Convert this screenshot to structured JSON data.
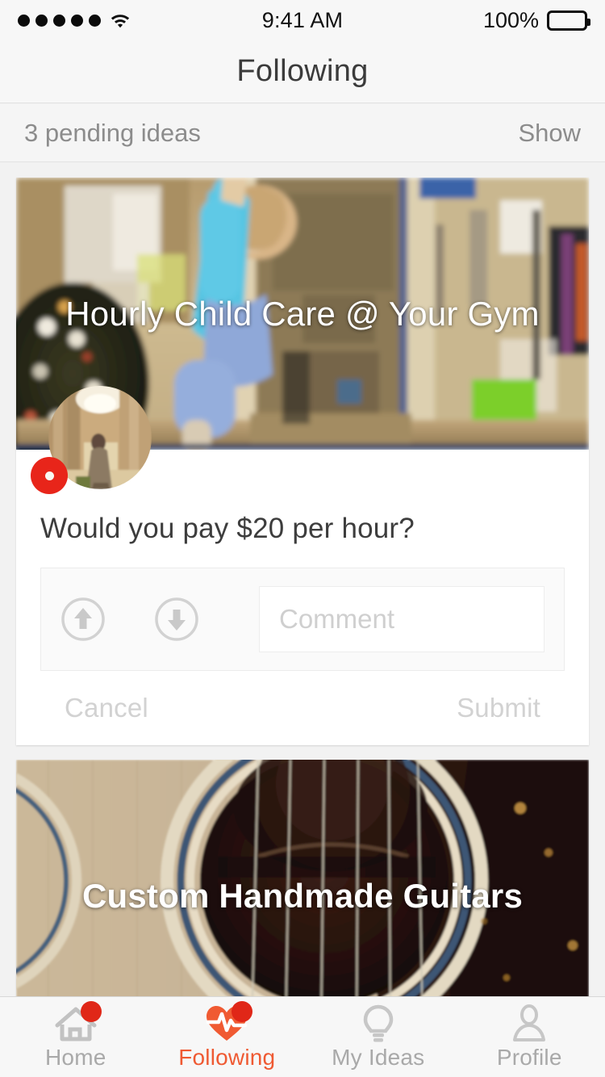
{
  "status_bar": {
    "signal_dots": 5,
    "wifi_icon": "wifi-icon",
    "time": "9:41 AM",
    "battery_percent": "100%",
    "battery_icon": "battery-full-icon"
  },
  "nav": {
    "title": "Following"
  },
  "pending": {
    "label": "3 pending ideas",
    "action": "Show"
  },
  "feed": {
    "cards": [
      {
        "title": "Hourly Child Care @ Your Gym",
        "image_alt": "child swinging in a gym child-care room with christmas tree",
        "avatar_alt": "user photo in stone ruins",
        "avatar_badge": "record-badge",
        "question": "Would you pay $20 per hour?",
        "upvote_icon": "arrow-up-circle-icon",
        "downvote_icon": "arrow-down-circle-icon",
        "comment_placeholder": "Comment",
        "comment_value": "",
        "cancel_label": "Cancel",
        "submit_label": "Submit"
      },
      {
        "title": "Custom Handmade Guitars",
        "image_alt": "close up of acoustic guitar soundhole and rosette"
      }
    ]
  },
  "tabs": [
    {
      "label": "Home",
      "icon": "home-icon",
      "active": false,
      "badge": true
    },
    {
      "label": "Following",
      "icon": "heartbeat-icon",
      "active": true,
      "badge": true
    },
    {
      "label": "My Ideas",
      "icon": "lightbulb-icon",
      "active": false,
      "badge": false
    },
    {
      "label": "Profile",
      "icon": "person-icon",
      "active": false,
      "badge": false
    }
  ],
  "colors": {
    "accent": "#ef5a33",
    "badge_red": "#e02718",
    "avatar_badge_red": "#e8251a",
    "muted_text": "#a9a9a9",
    "bg": "#f2f2f2"
  }
}
